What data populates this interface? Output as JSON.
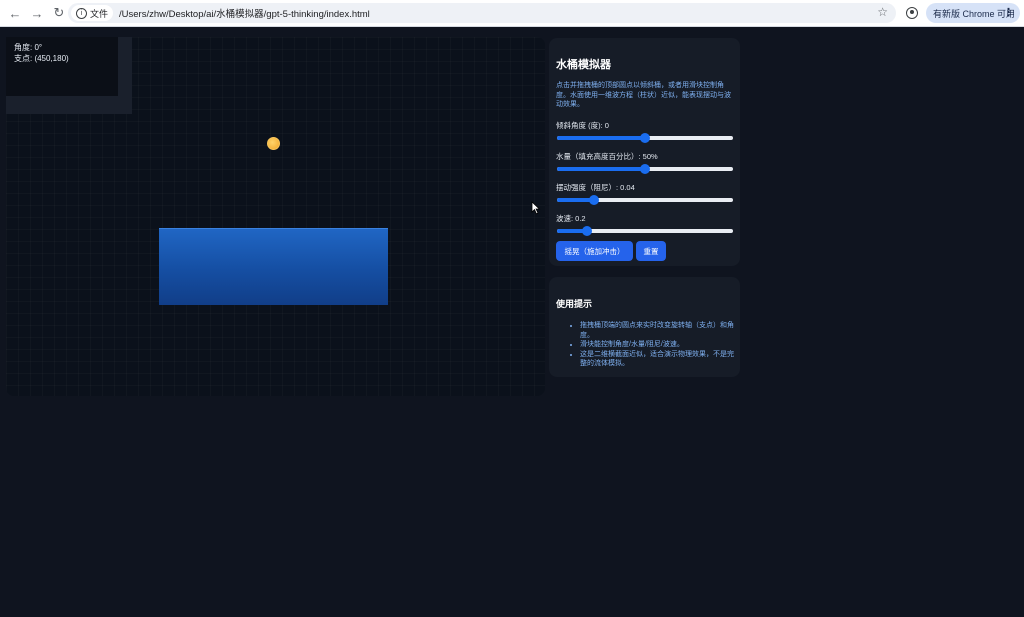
{
  "browser": {
    "file_label": "文件",
    "url": "/Users/zhw/Desktop/ai/水桶模拟器/gpt-5-thinking/index.html",
    "update_label": "有新版 Chrome 可用"
  },
  "hud": {
    "angle_text": "角度: 0°",
    "pivot_text": "支点: (450,180)"
  },
  "controls": {
    "title": "水桶模拟器",
    "description": "点击并拖拽桶的顶部圆点以倾斜桶，或者用滑块控制角度。水面使用一维波方程（柱状）近似，能表现摆动与波动效果。",
    "sliders": [
      {
        "label": "倾斜角度 (度): 0",
        "value_fraction": 0.5
      },
      {
        "label": "水量（填充高度百分比）: 50%",
        "value_fraction": 0.5
      },
      {
        "label": "摆动强度（阻尼）: 0.04",
        "value_fraction": 0.21
      },
      {
        "label": "波速: 0.2",
        "value_fraction": 0.17
      }
    ],
    "shake_button": "摇晃（施加冲击）",
    "reset_button": "重置"
  },
  "tips": {
    "title": "使用提示",
    "items": [
      "拖拽桶顶端的圆点来实时改变旋转轴（支点）和角度。",
      "滑块能控制角度/水量/阻尼/波速。",
      "这是二维横截面近似，适合演示物理效果，不是完整的流体模拟。"
    ]
  },
  "colors": {
    "accent": "#2563eb",
    "water": "#1a5cb8",
    "pivot": "#f5b233"
  }
}
